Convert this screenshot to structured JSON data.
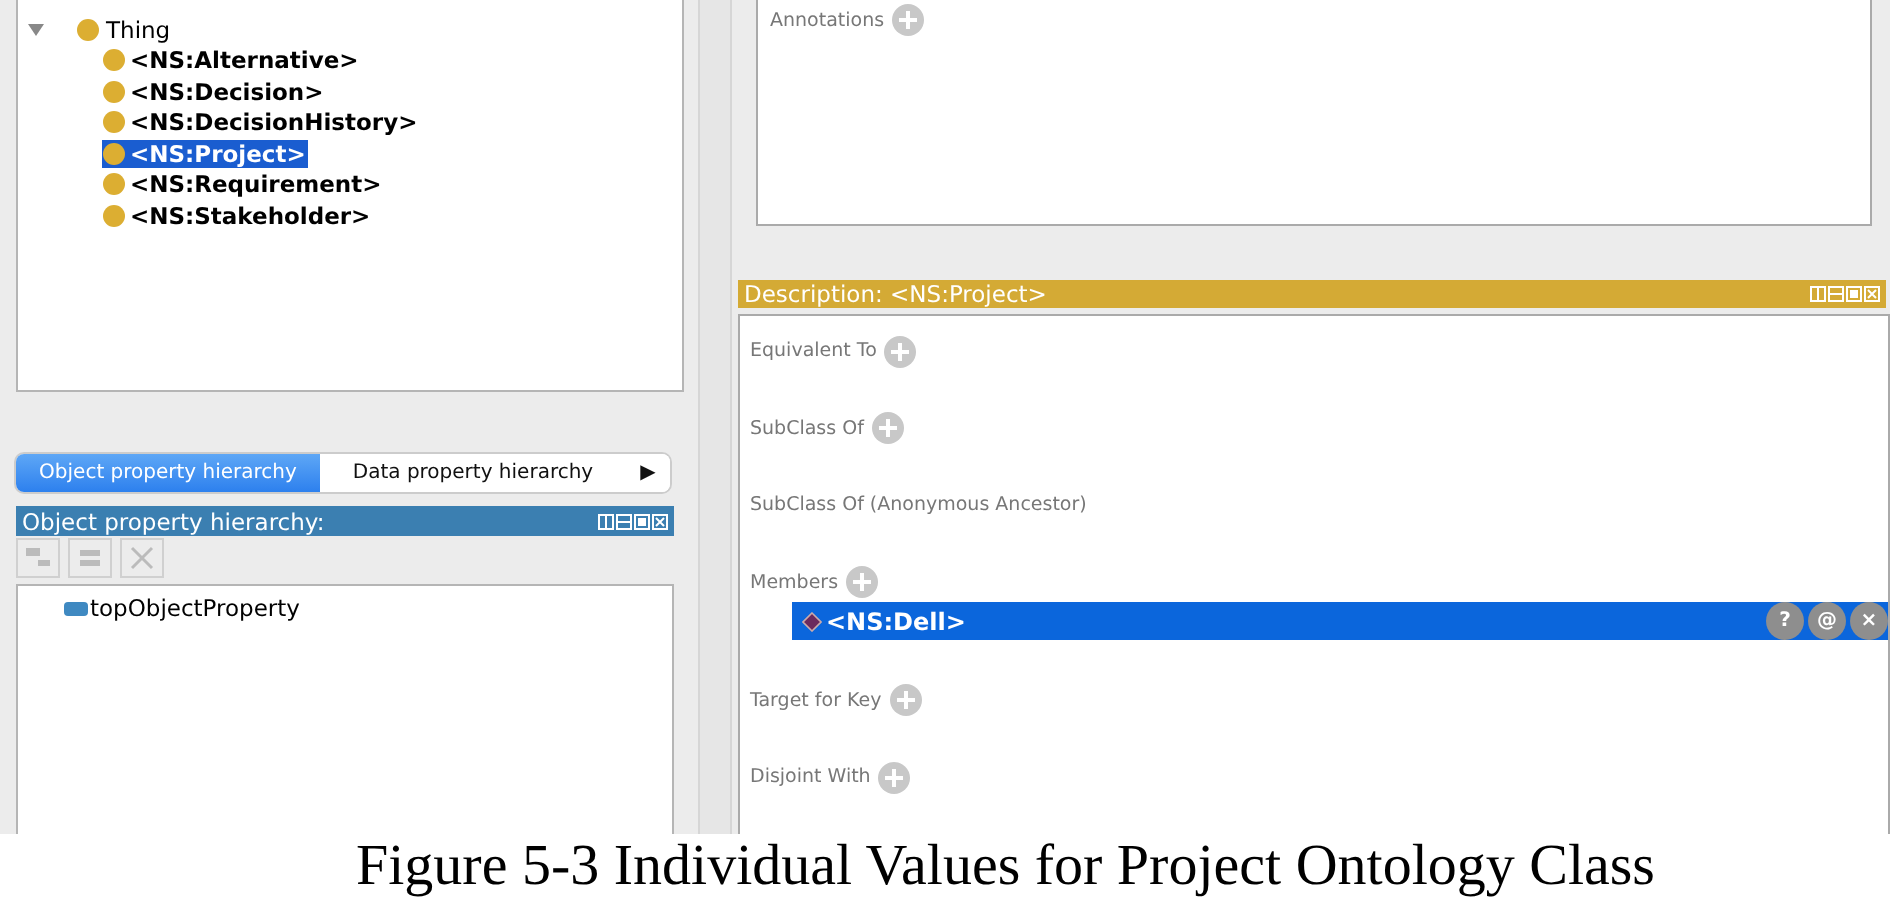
{
  "class_tree": {
    "root": {
      "label": "Thing",
      "expanded": true,
      "children": [
        {
          "label": "<NS:Alternative>",
          "selected": false
        },
        {
          "label": "<NS:Decision>",
          "selected": false
        },
        {
          "label": "<NS:DecisionHistory>",
          "selected": false
        },
        {
          "label": "<NS:Project>",
          "selected": true
        },
        {
          "label": "<NS:Requirement>",
          "selected": false
        },
        {
          "label": "<NS:Stakeholder>",
          "selected": false
        }
      ]
    }
  },
  "property_tabs": [
    {
      "label": "Object property hierarchy",
      "selected": true
    },
    {
      "label": "Data property hierarchy",
      "selected": false
    }
  ],
  "tabs_more": "▶",
  "property_panel": {
    "title": "Object property hierarchy:",
    "items": [
      {
        "label": "topObjectProperty"
      }
    ]
  },
  "annotations": {
    "label": "Annotations"
  },
  "description": {
    "title": "Description: <NS:Project>",
    "sections": [
      {
        "label": "Equivalent To",
        "addable": true
      },
      {
        "label": "SubClass Of",
        "addable": true
      },
      {
        "label": "SubClass Of (Anonymous Ancestor)",
        "addable": false
      },
      {
        "label": "Members",
        "addable": true,
        "items": [
          {
            "label": "<NS:Dell>",
            "selected": true,
            "actions": [
              "?",
              "@",
              "×"
            ]
          }
        ]
      },
      {
        "label": "Target for Key",
        "addable": true
      },
      {
        "label": "Disjoint With",
        "addable": true
      }
    ]
  },
  "caption": "Figure 5-3 Individual Values for Project Ontology Class"
}
